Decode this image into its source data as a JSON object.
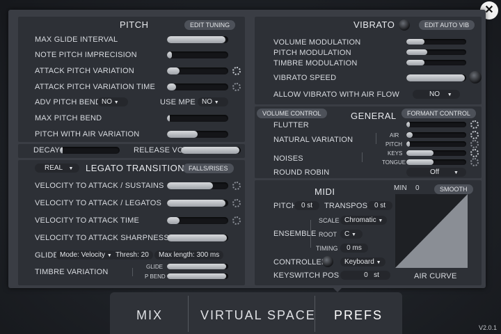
{
  "pitch": {
    "title": "PITCH",
    "edit_tuning": "EDIT TUNING",
    "rows": [
      {
        "label": "MAX GLIDE INTERVAL",
        "value": 0.95
      },
      {
        "label": "NOTE PITCH IMPRECISION",
        "value": 0.08
      },
      {
        "label": "ATTACK PITCH VARIATION",
        "value": 0.2
      },
      {
        "label": "ATTACK PITCH VARIATION TIME",
        "value": 0.15
      }
    ],
    "adv_pitch_bend": {
      "label": "ADV PITCH BEND",
      "value": "NO"
    },
    "use_mpe": {
      "label": "USE MPE",
      "value": "NO"
    },
    "max_pitch_bend": {
      "label": "MAX PITCH BEND",
      "value": 0.05
    },
    "pitch_with_air": {
      "label": "PITCH WITH AIR VARIATION",
      "value": 0.5
    }
  },
  "decay": {
    "label": "DECAY",
    "value": 0.05
  },
  "release_vol": {
    "label": "RELEASE VOL",
    "value": 0.98
  },
  "legato": {
    "mode": "REAL",
    "title": "LEGATO TRANSITIONS",
    "falls_rises": "FALLS/RISES",
    "rows": [
      {
        "label": "VELOCITY TO ATTACK / SUSTAINS",
        "value": 0.75
      },
      {
        "label": "VELOCITY TO ATTACK / LEGATOS",
        "value": 0.95
      },
      {
        "label": "VELOCITY TO ATTACK TIME",
        "value": 0.2
      },
      {
        "label": "VELOCITY TO ATTACK SHARPNESS",
        "value": 0.98
      }
    ],
    "glide": {
      "label": "GLIDE",
      "mode": "Mode: Velocity",
      "thresh": "Thresh: 20",
      "max_length": "Max length:  300 ms"
    },
    "timbre_variation": {
      "label": "TIMBRE VARIATION",
      "glide_label": "GLIDE",
      "pbend_label": "P BEND",
      "glide_value": 0.97,
      "pbend_value": 0.97
    }
  },
  "vibrato": {
    "title": "VIBRATO",
    "edit_auto_vib": "EDIT AUTO VIB",
    "rows": [
      {
        "label": "VOLUME MODULATION",
        "value": 0.3
      },
      {
        "label": "PITCH MODULATION",
        "value": 0.35
      },
      {
        "label": "TIMBRE MODULATION",
        "value": 0.3
      }
    ],
    "speed": {
      "label": "VIBRATO SPEED",
      "value": 0.98
    },
    "air_flow": {
      "label": "ALLOW VIBRATO WITH AIR FLOW",
      "value": "NO"
    }
  },
  "general": {
    "volume_control": "VOLUME CONTROL",
    "title": "GENERAL",
    "formant_control": "FORMANT CONTROL",
    "flutter": {
      "label": "FLUTTER",
      "value": 0.06
    },
    "natural_variation": {
      "label": "NATURAL VARIATION",
      "air_label": "AIR",
      "pitch_label": "PITCH",
      "air_value": 0.1,
      "pitch_value": 0.06
    },
    "noises": {
      "label": "NOISES",
      "keys_label": "KEYS",
      "tongue_label": "TONGUE",
      "keys_value": 0.45,
      "tongue_value": 0.45
    },
    "round_robin": {
      "label": "ROUND ROBIN",
      "value": "Off"
    }
  },
  "midi": {
    "title": "MIDI",
    "min_label": "MIN",
    "min_value": "0",
    "smooth": "SMOOTH",
    "pitch": {
      "label": "PITCH",
      "value": "0 st"
    },
    "transpose": {
      "label": "TRANSPOSE",
      "value": "0 st"
    },
    "ensemble": "ENSEMBLE",
    "scale": {
      "label": "SCALE",
      "value": "Chromatic"
    },
    "root": {
      "label": "ROOT",
      "value": "C"
    },
    "timing": {
      "label": "TIMING",
      "value": "0 ms"
    },
    "controller": {
      "label": "CONTROLLER",
      "value": "Keyboard"
    },
    "keyswitch": {
      "label": "KEYSWITCH POS",
      "value": "0",
      "unit": "st"
    },
    "air_curve": "AIR CURVE"
  },
  "tabs": [
    "MIX",
    "VIRTUAL SPACE",
    "PREFS"
  ],
  "active_tab": "PREFS",
  "version": "V2.0.1",
  "close_glyph": "✕"
}
